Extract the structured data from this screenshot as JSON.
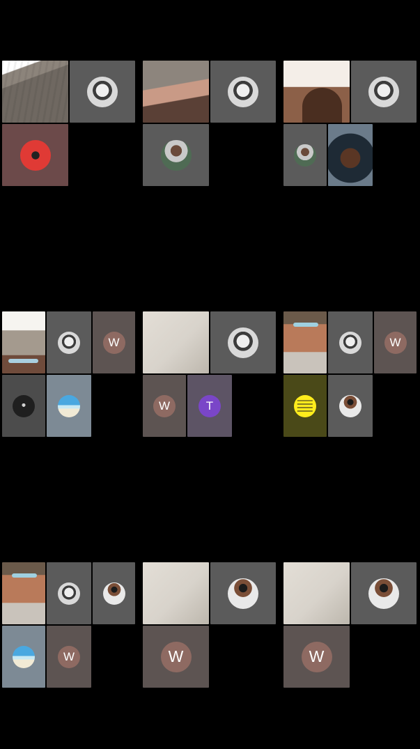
{
  "screen": {
    "background": "#000000"
  },
  "tiles": {
    "w_label": "W",
    "t_label": "T"
  },
  "colors": {
    "letter_circle": "#8e6a62",
    "letter_circle_purple": "#7a46c8"
  }
}
